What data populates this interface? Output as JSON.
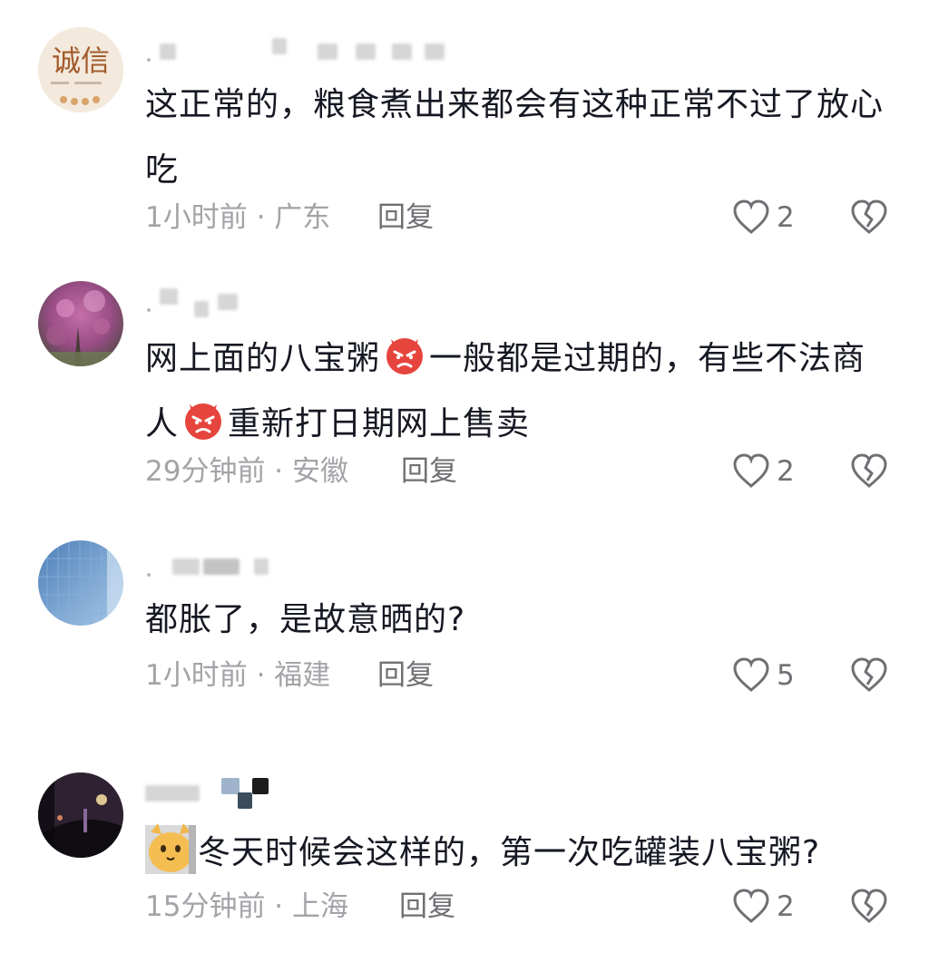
{
  "comments": [
    {
      "text": "这正常的，粮食煮出来都会有这种正常不过了放心吃",
      "time": "1小时前",
      "location": "广东",
      "reply_label": "回复",
      "likes": "2",
      "avatar_text": "诚信"
    },
    {
      "text_parts": [
        "网上面的八宝粥",
        "一般都是过期的，有些不法商人",
        "重新打日期网上售卖"
      ],
      "time": "29分钟前",
      "location": "安徽",
      "reply_label": "回复",
      "likes": "2"
    },
    {
      "text": "都胀了，是故意晒的?",
      "time": "1小时前",
      "location": "福建",
      "reply_label": "回复",
      "likes": "5"
    },
    {
      "text": "冬天时候会这样的，第一次吃罐装八宝粥?",
      "time": "15分钟前",
      "location": "上海",
      "reply_label": "回复",
      "likes": "2"
    }
  ],
  "meta_separator": " · ",
  "icons": {
    "like": "heart-outline-icon",
    "dislike": "broken-heart-icon",
    "emoji": "angry-face-emoji"
  },
  "colors": {
    "text": "#161823",
    "meta": "#a3a3a8",
    "reply": "#6f6f74",
    "icon": "#6f6f74",
    "emoji_red": "#e5453d"
  }
}
